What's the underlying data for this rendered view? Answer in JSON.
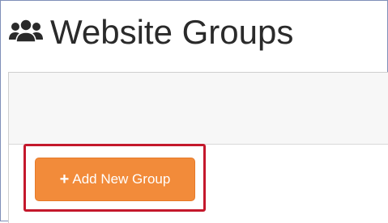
{
  "page": {
    "title": "Website Groups",
    "title_icon": "users-icon"
  },
  "actions": {
    "add_group_label": "Add New Group",
    "add_group_icon": "plus-icon",
    "add_group_plus": "+"
  },
  "colors": {
    "button_bg": "#f28b3a",
    "highlight": "#c4182c",
    "title_text": "#2a2a2a"
  }
}
